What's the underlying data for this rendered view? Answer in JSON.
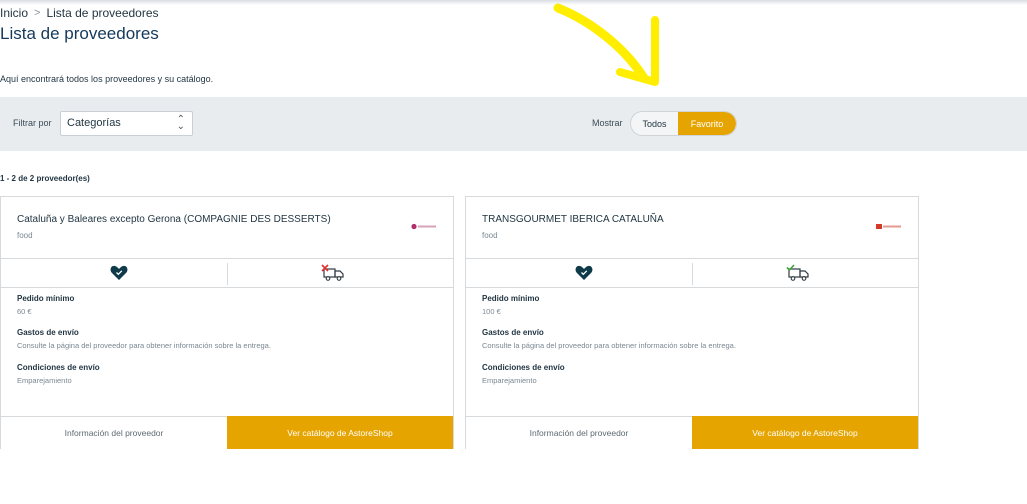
{
  "breadcrumb": {
    "home": "Inicio",
    "separator": ">",
    "current": "Lista de proveedores"
  },
  "page": {
    "title": "Lista de proveedores",
    "intro": "Aquí encontrará todos los proveedores y su catálogo."
  },
  "filter": {
    "label": "Filtrar por",
    "select_value": "Categorías",
    "show_label": "Mostrar",
    "toggle_all": "Todos",
    "toggle_fav": "Favorito",
    "active": "Favorito"
  },
  "results": {
    "count_text": "1 - 2 de 2 proveedor(es)"
  },
  "suppliers": [
    {
      "name": "Cataluña y Baleares excepto Gerona (COMPAGNIE DES DESSERTS)",
      "category": "food",
      "favorite": true,
      "delivery_icon": "truck-cancel-icon",
      "min_order_label": "Pedido mínimo",
      "min_order_value": "60 €",
      "shipping_label": "Gastos de envío",
      "shipping_value": "Consulte la página del proveedor para obtener información sobre la entrega.",
      "conditions_label": "Condiciones de envío",
      "conditions_value": "Emparejamiento",
      "info_button": "Información del proveedor",
      "catalog_button": "Ver catálogo de AstoreShop"
    },
    {
      "name": "TRANSGOURMET IBERICA CATALUÑA",
      "category": "food",
      "favorite": true,
      "delivery_icon": "truck-check-icon",
      "min_order_label": "Pedido mínimo",
      "min_order_value": "100 €",
      "shipping_label": "Gastos de envío",
      "shipping_value": "Consulte la página del proveedor para obtener información sobre la entrega.",
      "conditions_label": "Condiciones de envío",
      "conditions_value": "Emparejamiento",
      "info_button": "Información del proveedor",
      "catalog_button": "Ver catálogo de AstoreShop"
    }
  ],
  "colors": {
    "accent": "#e6a400",
    "title": "#14395a",
    "annotation_arrow": "#ffee00"
  }
}
